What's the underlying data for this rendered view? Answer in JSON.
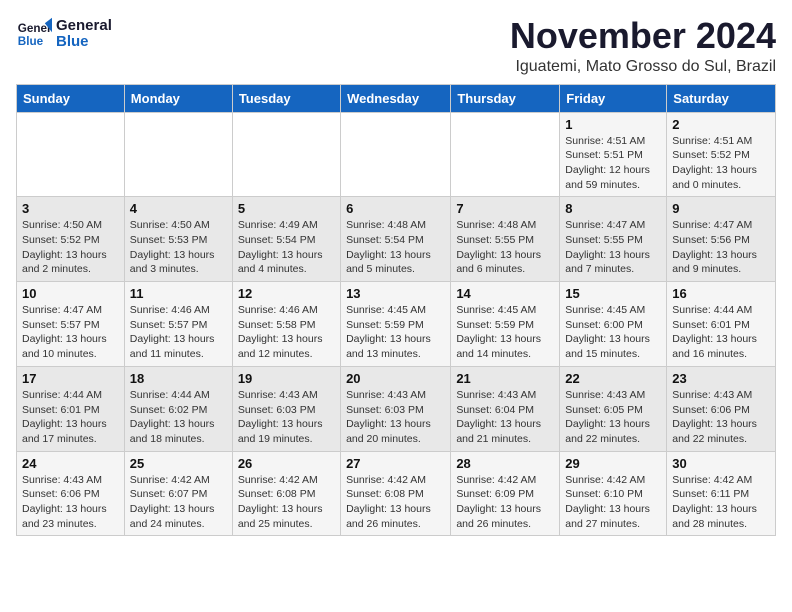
{
  "header": {
    "logo_general": "General",
    "logo_blue": "Blue",
    "title": "November 2024",
    "subtitle": "Iguatemi, Mato Grosso do Sul, Brazil"
  },
  "weekdays": [
    "Sunday",
    "Monday",
    "Tuesday",
    "Wednesday",
    "Thursday",
    "Friday",
    "Saturday"
  ],
  "weeks": [
    [
      {
        "day": "",
        "info": ""
      },
      {
        "day": "",
        "info": ""
      },
      {
        "day": "",
        "info": ""
      },
      {
        "day": "",
        "info": ""
      },
      {
        "day": "",
        "info": ""
      },
      {
        "day": "1",
        "info": "Sunrise: 4:51 AM\nSunset: 5:51 PM\nDaylight: 12 hours and 59 minutes."
      },
      {
        "day": "2",
        "info": "Sunrise: 4:51 AM\nSunset: 5:52 PM\nDaylight: 13 hours and 0 minutes."
      }
    ],
    [
      {
        "day": "3",
        "info": "Sunrise: 4:50 AM\nSunset: 5:52 PM\nDaylight: 13 hours and 2 minutes."
      },
      {
        "day": "4",
        "info": "Sunrise: 4:50 AM\nSunset: 5:53 PM\nDaylight: 13 hours and 3 minutes."
      },
      {
        "day": "5",
        "info": "Sunrise: 4:49 AM\nSunset: 5:54 PM\nDaylight: 13 hours and 4 minutes."
      },
      {
        "day": "6",
        "info": "Sunrise: 4:48 AM\nSunset: 5:54 PM\nDaylight: 13 hours and 5 minutes."
      },
      {
        "day": "7",
        "info": "Sunrise: 4:48 AM\nSunset: 5:55 PM\nDaylight: 13 hours and 6 minutes."
      },
      {
        "day": "8",
        "info": "Sunrise: 4:47 AM\nSunset: 5:55 PM\nDaylight: 13 hours and 7 minutes."
      },
      {
        "day": "9",
        "info": "Sunrise: 4:47 AM\nSunset: 5:56 PM\nDaylight: 13 hours and 9 minutes."
      }
    ],
    [
      {
        "day": "10",
        "info": "Sunrise: 4:47 AM\nSunset: 5:57 PM\nDaylight: 13 hours and 10 minutes."
      },
      {
        "day": "11",
        "info": "Sunrise: 4:46 AM\nSunset: 5:57 PM\nDaylight: 13 hours and 11 minutes."
      },
      {
        "day": "12",
        "info": "Sunrise: 4:46 AM\nSunset: 5:58 PM\nDaylight: 13 hours and 12 minutes."
      },
      {
        "day": "13",
        "info": "Sunrise: 4:45 AM\nSunset: 5:59 PM\nDaylight: 13 hours and 13 minutes."
      },
      {
        "day": "14",
        "info": "Sunrise: 4:45 AM\nSunset: 5:59 PM\nDaylight: 13 hours and 14 minutes."
      },
      {
        "day": "15",
        "info": "Sunrise: 4:45 AM\nSunset: 6:00 PM\nDaylight: 13 hours and 15 minutes."
      },
      {
        "day": "16",
        "info": "Sunrise: 4:44 AM\nSunset: 6:01 PM\nDaylight: 13 hours and 16 minutes."
      }
    ],
    [
      {
        "day": "17",
        "info": "Sunrise: 4:44 AM\nSunset: 6:01 PM\nDaylight: 13 hours and 17 minutes."
      },
      {
        "day": "18",
        "info": "Sunrise: 4:44 AM\nSunset: 6:02 PM\nDaylight: 13 hours and 18 minutes."
      },
      {
        "day": "19",
        "info": "Sunrise: 4:43 AM\nSunset: 6:03 PM\nDaylight: 13 hours and 19 minutes."
      },
      {
        "day": "20",
        "info": "Sunrise: 4:43 AM\nSunset: 6:03 PM\nDaylight: 13 hours and 20 minutes."
      },
      {
        "day": "21",
        "info": "Sunrise: 4:43 AM\nSunset: 6:04 PM\nDaylight: 13 hours and 21 minutes."
      },
      {
        "day": "22",
        "info": "Sunrise: 4:43 AM\nSunset: 6:05 PM\nDaylight: 13 hours and 22 minutes."
      },
      {
        "day": "23",
        "info": "Sunrise: 4:43 AM\nSunset: 6:06 PM\nDaylight: 13 hours and 22 minutes."
      }
    ],
    [
      {
        "day": "24",
        "info": "Sunrise: 4:43 AM\nSunset: 6:06 PM\nDaylight: 13 hours and 23 minutes."
      },
      {
        "day": "25",
        "info": "Sunrise: 4:42 AM\nSunset: 6:07 PM\nDaylight: 13 hours and 24 minutes."
      },
      {
        "day": "26",
        "info": "Sunrise: 4:42 AM\nSunset: 6:08 PM\nDaylight: 13 hours and 25 minutes."
      },
      {
        "day": "27",
        "info": "Sunrise: 4:42 AM\nSunset: 6:08 PM\nDaylight: 13 hours and 26 minutes."
      },
      {
        "day": "28",
        "info": "Sunrise: 4:42 AM\nSunset: 6:09 PM\nDaylight: 13 hours and 26 minutes."
      },
      {
        "day": "29",
        "info": "Sunrise: 4:42 AM\nSunset: 6:10 PM\nDaylight: 13 hours and 27 minutes."
      },
      {
        "day": "30",
        "info": "Sunrise: 4:42 AM\nSunset: 6:11 PM\nDaylight: 13 hours and 28 minutes."
      }
    ]
  ]
}
